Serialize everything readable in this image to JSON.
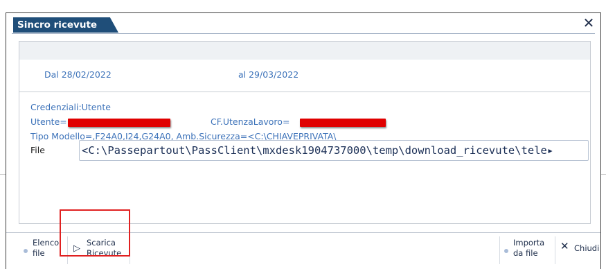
{
  "dialog": {
    "title": "Sincro ricevute",
    "close_symbol": "✕"
  },
  "period": {
    "from_label": "Dal 28/02/2022",
    "to_label": "al 29/03/2022"
  },
  "credentials": {
    "header": "Credenziali:Utente",
    "utente_label": "Utente=",
    "cf_label": "CF.UtenzaLavoro=",
    "tipo_line": "Tipo Modello=,F24A0,I24,G24A0,  Amb.Sicurezza=<C:\\CHIAVEPRIVATA\\"
  },
  "file": {
    "label": "File",
    "value": "<C:\\Passepartout\\PassClient\\mxdesk1904737000\\temp\\download_ricevute\\tele▸"
  },
  "toolbar": {
    "elenco_line1": "Elenco",
    "elenco_line2": "file",
    "scarica_line1": "Scarica",
    "scarica_line2": "Ricevute",
    "importa_line1": "Importa",
    "importa_line2": "da file",
    "chiudi_label": "Chiudi"
  },
  "colors": {
    "title_bg": "#1f4e79",
    "label_blue": "#3c72b9",
    "redaction": "#e00000",
    "highlight": "#e02020"
  }
}
